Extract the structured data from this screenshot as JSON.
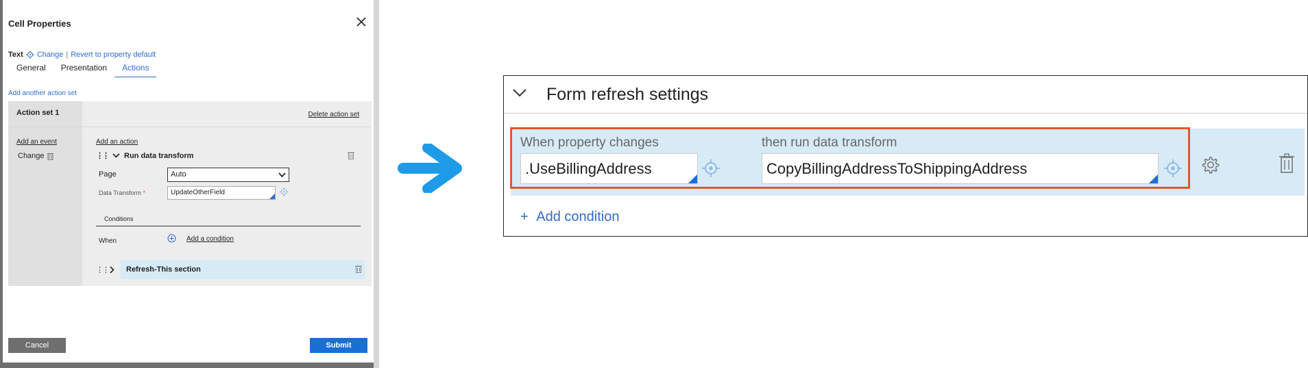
{
  "modal": {
    "title": "Cell Properties",
    "text_label": "Text",
    "change_link": "Change",
    "separator": "|",
    "revert_link": "Revert to property default",
    "tabs": [
      {
        "label": "General"
      },
      {
        "label": "Presentation"
      },
      {
        "label": "Actions",
        "active": true
      }
    ],
    "add_action_set": "Add another action set",
    "action_set": {
      "title": "Action set 1",
      "delete_label": "Delete action set",
      "add_event": "Add an event",
      "event": "Change",
      "add_action": "Add an action",
      "action_name": "Run data transform",
      "page_label": "Page",
      "page_value": "Auto",
      "data_transform_label": "Data Transform",
      "data_transform_required": "*",
      "data_transform_value": "UpdateOtherField",
      "conditions_label": "Conditions",
      "when_label": "When",
      "add_condition": "Add a condition",
      "refresh_action": "Refresh-This section"
    },
    "cancel_label": "Cancel",
    "submit_label": "Submit"
  },
  "form_refresh": {
    "title": "Form refresh settings",
    "when_label": "When property changes",
    "when_value": ".UseBillingAddress",
    "then_label": "then run data transform",
    "then_value": "CopyBillingAddressToShippingAddress",
    "add_condition": "Add condition",
    "add_prefix": "+"
  },
  "colors": {
    "accent": "#2f6bc9",
    "primary_button": "#1a6fd6",
    "highlight_border": "#e0582a",
    "row_background": "#d7ebf6",
    "arrow": "#1e9be8"
  },
  "icons": [
    "close-icon",
    "crosshair-icon",
    "grip-icon",
    "chevron-down-icon",
    "chevron-right-icon",
    "trash-icon",
    "plus-circle-icon",
    "gear-icon",
    "arrow-right-icon"
  ]
}
